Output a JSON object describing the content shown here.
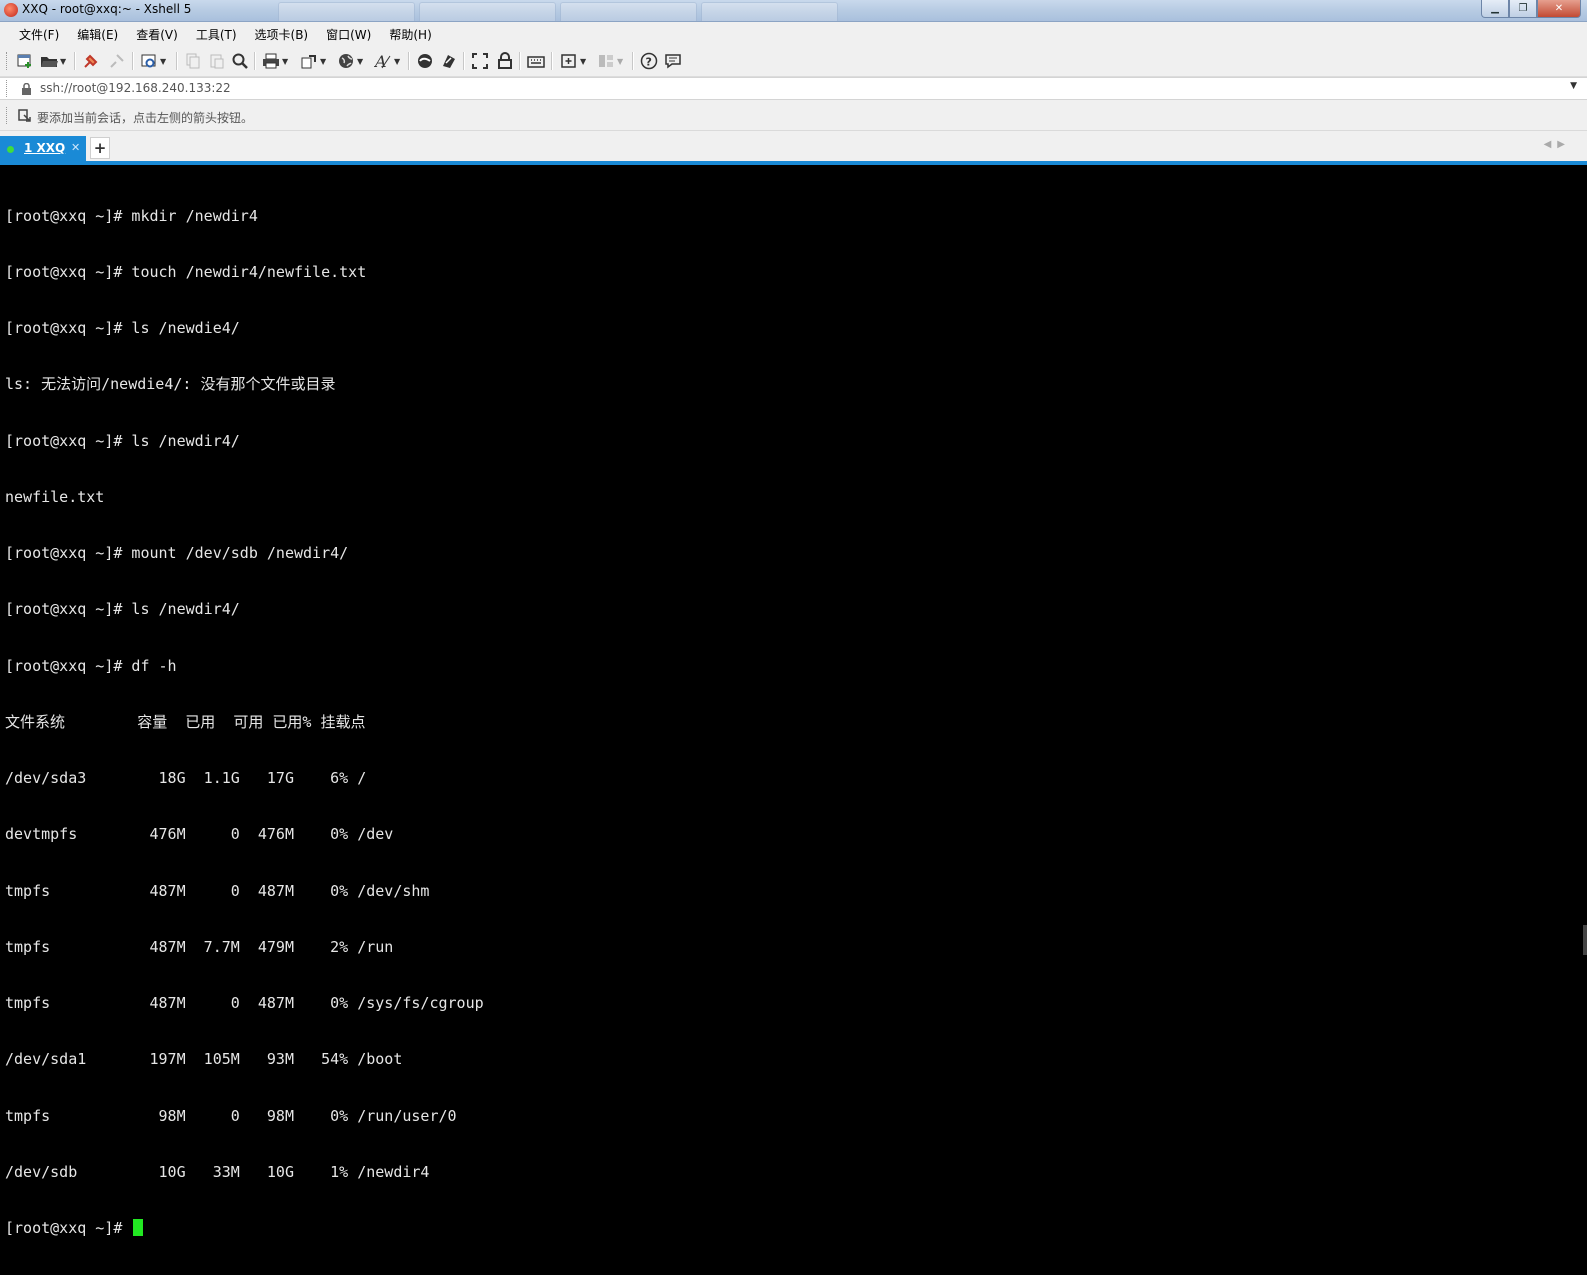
{
  "window": {
    "title": "XXQ - root@xxq:~ - Xshell 5",
    "controls": [
      "minimize",
      "restore",
      "close"
    ]
  },
  "menu": [
    "文件(F)",
    "编辑(E)",
    "查看(V)",
    "工具(T)",
    "选项卡(B)",
    "窗口(W)",
    "帮助(H)"
  ],
  "toolbar_icons": [
    "new-session-icon",
    "open-folder-icon",
    "connect-icon",
    "disconnect-icon",
    "properties-icon",
    "copy-icon",
    "paste-icon",
    "find-icon",
    "print-icon",
    "transfer-icon",
    "globe-icon",
    "font-icon",
    "xftp-icon",
    "xmanager-icon",
    "fullscreen-icon",
    "lock-icon",
    "keyboard-icon",
    "new-tab-icon",
    "layout-icon",
    "help-icon",
    "chat-icon"
  ],
  "address": {
    "url": "ssh://root@192.168.240.133:22",
    "lock_icon": "lock-icon"
  },
  "hint": {
    "text": "要添加当前会话，点击左侧的箭头按钮。"
  },
  "tabs": [
    {
      "label": "1 XXQ",
      "active": true,
      "status_color": "#3fdc3f"
    }
  ],
  "colors": {
    "accent": "#1a8ad6",
    "terminal_bg": "#000000",
    "terminal_fg": "#e6e6e6",
    "cursor": "#22e822"
  },
  "terminal": {
    "lines": [
      "[root@xxq ~]# mkdir /newdir4",
      "[root@xxq ~]# touch /newdir4/newfile.txt",
      "[root@xxq ~]# ls /newdie4/",
      "ls: 无法访问/newdie4/: 没有那个文件或目录",
      "[root@xxq ~]# ls /newdir4/",
      "newfile.txt",
      "[root@xxq ~]# mount /dev/sdb /newdir4/",
      "[root@xxq ~]# ls /newdir4/",
      "[root@xxq ~]# df -h",
      "文件系统        容量  已用  可用 已用% 挂载点",
      "/dev/sda3        18G  1.1G   17G    6% /",
      "devtmpfs        476M     0  476M    0% /dev",
      "tmpfs           487M     0  487M    0% /dev/shm",
      "tmpfs           487M  7.7M  479M    2% /run",
      "tmpfs           487M     0  487M    0% /sys/fs/cgroup",
      "/dev/sda1       197M  105M   93M   54% /boot",
      "tmpfs            98M     0   98M    0% /run/user/0",
      "/dev/sdb         10G   33M   10G    1% /newdir4"
    ],
    "prompt": "[root@xxq ~]# "
  }
}
